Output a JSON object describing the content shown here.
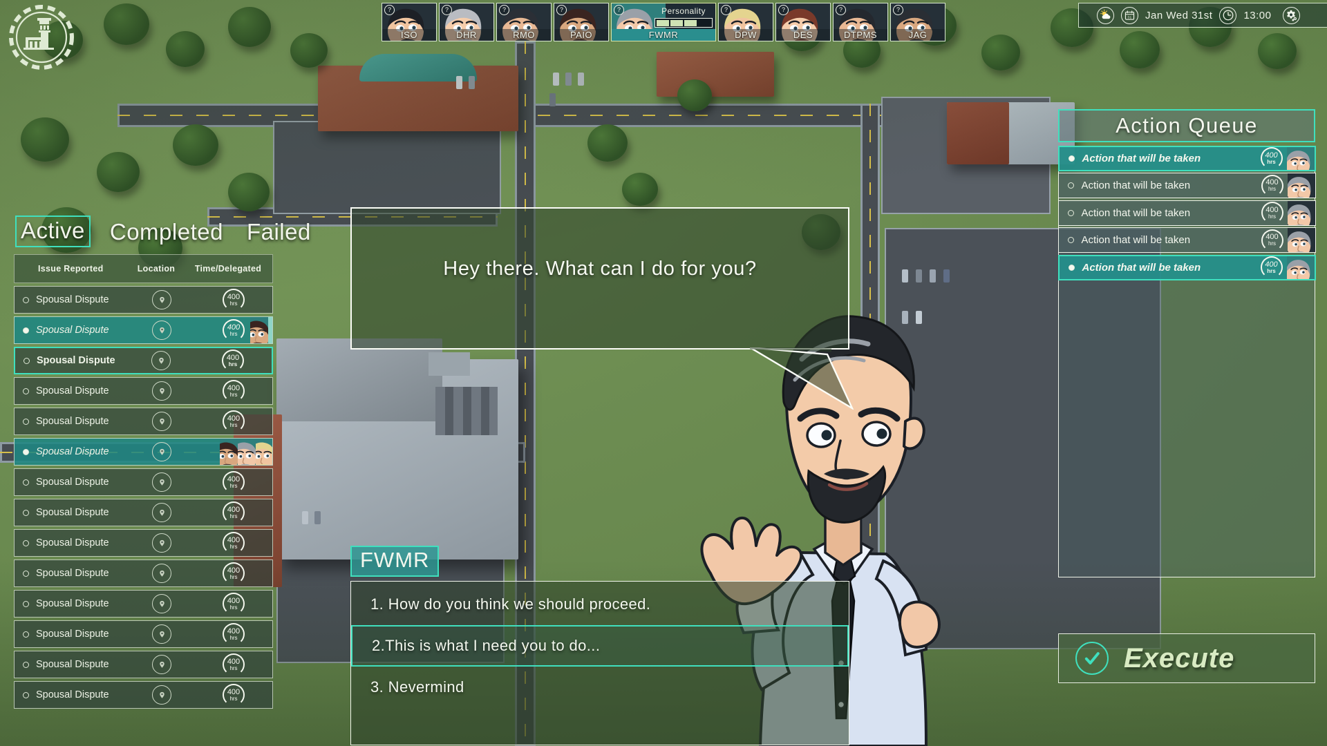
{
  "app": {
    "logo_icon": "city-hall-icon"
  },
  "topbar": {
    "weather_icon": "sun-cloud-icon",
    "calendar_icon": "calendar-icon",
    "date": "Jan Wed 31st",
    "clock_icon": "clock-icon",
    "time": "13:00",
    "settings_icon": "gear-icon"
  },
  "portraits": {
    "badge": "?",
    "personality_label": "Personality",
    "personality_filled": 3,
    "personality_total": 4,
    "items": [
      {
        "name": "ISO",
        "active": false
      },
      {
        "name": "DHR",
        "active": false
      },
      {
        "name": "RMO",
        "active": false
      },
      {
        "name": "PAIO",
        "active": false
      },
      {
        "name": "FWMR",
        "active": true
      },
      {
        "name": "DPW",
        "active": false
      },
      {
        "name": "DES",
        "active": false
      },
      {
        "name": "DTPMS",
        "active": false
      },
      {
        "name": "JAG",
        "active": false
      }
    ]
  },
  "tasks": {
    "tabs": [
      {
        "label": "Active",
        "selected": true
      },
      {
        "label": "Completed",
        "selected": false
      },
      {
        "label": "Failed",
        "selected": false
      }
    ],
    "columns": {
      "issue": "Issue Reported",
      "location": "Location",
      "time": "Time/Delegated"
    },
    "location_icon": "map-pin-icon",
    "rows": [
      {
        "issue": "Spousal Dispute",
        "hours": "400",
        "unit": "hrs",
        "state": "normal",
        "avatars": 0
      },
      {
        "issue": "Spousal Dispute",
        "hours": "400",
        "unit": "hrs",
        "state": "selected",
        "avatars": 1
      },
      {
        "issue": "Spousal Dispute",
        "hours": "400",
        "unit": "hrs",
        "state": "outlined",
        "avatars": 0
      },
      {
        "issue": "Spousal Dispute",
        "hours": "400",
        "unit": "hrs",
        "state": "normal",
        "avatars": 0
      },
      {
        "issue": "Spousal Dispute",
        "hours": "400",
        "unit": "hrs",
        "state": "normal",
        "avatars": 0
      },
      {
        "issue": "Spousal Dispute",
        "hours": "400",
        "unit": "hrs",
        "state": "selected",
        "avatars": 3
      },
      {
        "issue": "Spousal Dispute",
        "hours": "400",
        "unit": "hrs",
        "state": "normal",
        "avatars": 0
      },
      {
        "issue": "Spousal Dispute",
        "hours": "400",
        "unit": "hrs",
        "state": "normal",
        "avatars": 0
      },
      {
        "issue": "Spousal Dispute",
        "hours": "400",
        "unit": "hrs",
        "state": "normal",
        "avatars": 0
      },
      {
        "issue": "Spousal Dispute",
        "hours": "400",
        "unit": "hrs",
        "state": "normal",
        "avatars": 0
      },
      {
        "issue": "Spousal Dispute",
        "hours": "400",
        "unit": "hrs",
        "state": "normal",
        "avatars": 0
      },
      {
        "issue": "Spousal Dispute",
        "hours": "400",
        "unit": "hrs",
        "state": "normal",
        "avatars": 0
      },
      {
        "issue": "Spousal Dispute",
        "hours": "400",
        "unit": "hrs",
        "state": "normal",
        "avatars": 0
      },
      {
        "issue": "Spousal Dispute",
        "hours": "400",
        "unit": "hrs",
        "state": "normal",
        "avatars": 0
      }
    ]
  },
  "speech": {
    "text": "Hey there. What can I do for you?"
  },
  "dialogue": {
    "speaker": "FWMR",
    "options": [
      {
        "text": "1. How do you think we should proceed.",
        "selected": false
      },
      {
        "text": "2.This is what I need you to do...",
        "selected": true
      },
      {
        "text": "3. Nevermind",
        "selected": false
      }
    ]
  },
  "queue": {
    "title": "Action Queue",
    "rows": [
      {
        "text": "Action that will be taken",
        "hours": "400",
        "unit": "hrs",
        "state": "selected"
      },
      {
        "text": "Action that will be taken",
        "hours": "400",
        "unit": "hrs",
        "state": "normal"
      },
      {
        "text": "Action that will be taken",
        "hours": "400",
        "unit": "hrs",
        "state": "normal"
      },
      {
        "text": "Action that will be taken",
        "hours": "400",
        "unit": "hrs",
        "state": "normal"
      },
      {
        "text": "Action that will be taken",
        "hours": "400",
        "unit": "hrs",
        "state": "selected"
      }
    ],
    "execute_label": "Execute",
    "execute_icon": "check-circle-icon"
  },
  "colors": {
    "accent_teal": "#3fe0be",
    "row_teal": "#1f8682",
    "panel_green": "#4a6840",
    "text_light": "#f2f6ec"
  }
}
